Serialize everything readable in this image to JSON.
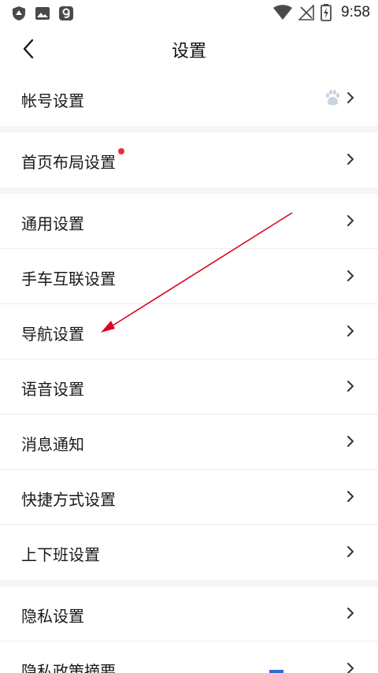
{
  "status_bar": {
    "time": "9:58",
    "left_icons": [
      "shield-icon",
      "image-icon",
      "app-9-icon"
    ],
    "right_icons": [
      "wifi-icon",
      "no-signal-icon",
      "battery-charging-icon"
    ]
  },
  "header": {
    "back_icon": "chevron-left-icon",
    "title": "设置"
  },
  "settings": {
    "account": {
      "label": "帐号设置",
      "extra_icon": "baidu-paw-icon"
    },
    "home_layout": {
      "label": "首页布局设置",
      "has_red_dot": true
    },
    "general": {
      "label": "通用设置"
    },
    "phone_car": {
      "label": "手车互联设置"
    },
    "navigation": {
      "label": "导航设置"
    },
    "voice": {
      "label": "语音设置"
    },
    "notifications": {
      "label": "消息通知"
    },
    "shortcuts": {
      "label": "快捷方式设置"
    },
    "commute": {
      "label": "上下班设置"
    },
    "privacy": {
      "label": "隐私设置"
    },
    "privacy_policy": {
      "label": "隐私政策摘要"
    }
  },
  "annotation": {
    "type": "red-arrow",
    "color": "#e0001b",
    "points_to": "navigation"
  },
  "colors": {
    "red_dot": "#e8303a",
    "section_gap": "#f4f5f7",
    "divider": "#ececec",
    "arrow": "#e0001b"
  }
}
